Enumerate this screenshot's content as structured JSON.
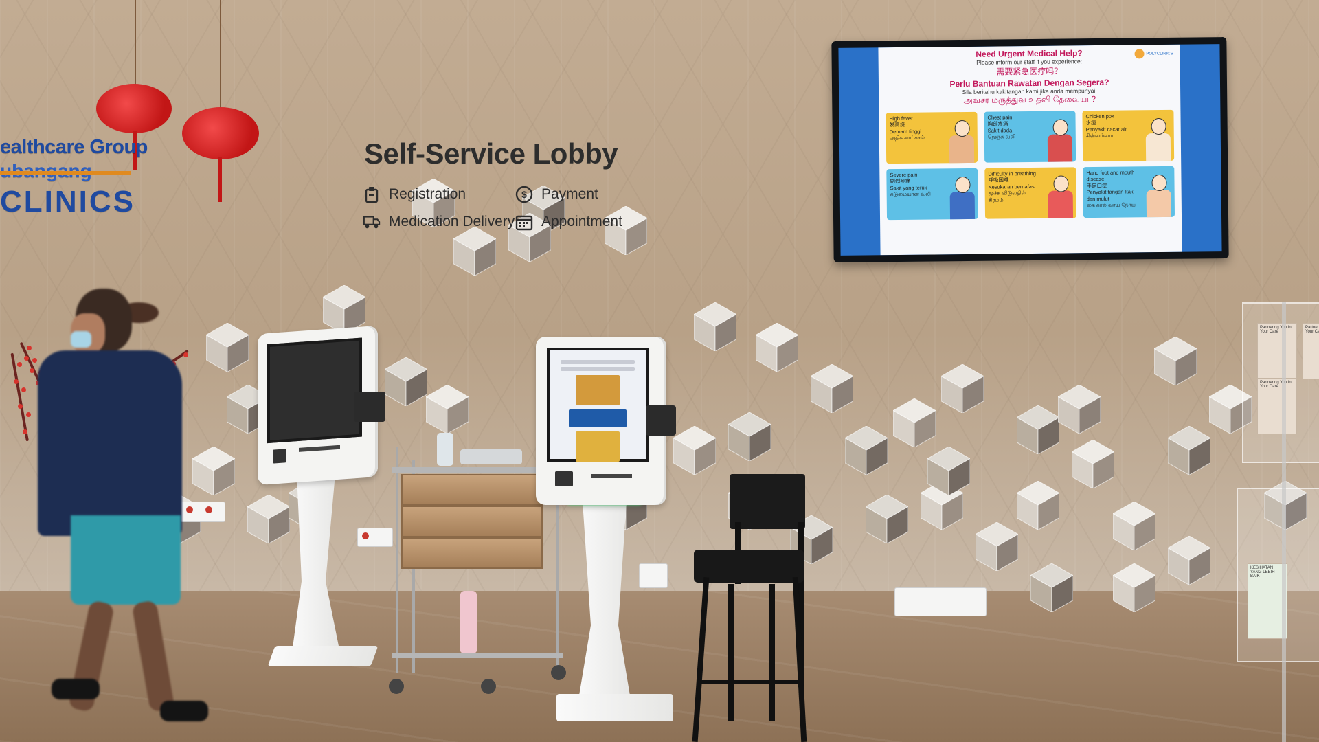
{
  "branding": {
    "line1": "ealthcare Group",
    "line2": "ubangang",
    "line3": "CLINICS",
    "color_primary": "#1f4aa0",
    "color_accent": "#e08a1f"
  },
  "lobby_sign": {
    "title": "Self-Service Lobby",
    "services": [
      {
        "label": "Registration",
        "icon": "registration-icon"
      },
      {
        "label": "Payment",
        "icon": "payment-icon"
      },
      {
        "label": "Medication Delivery",
        "icon": "delivery-truck-icon"
      },
      {
        "label": "Appointment",
        "icon": "calendar-icon"
      }
    ]
  },
  "tv_display": {
    "heading": "Need Urgent Medical Help?",
    "subheading": "Please inform our staff if you experience:",
    "chinese_line": "需要紧急医疗吗？",
    "malay_heading": "Perlu Bantuan Rawatan Dengan Segera?",
    "malay_sub": "Sila beritahu kakitangan kami jika anda mempunyai:",
    "tamil_line": "அவசர மருத்துவ உதவி தேவையா?",
    "logo_text": "POLYCLINICS",
    "cards": [
      {
        "en": "High fever",
        "zh": "发高烧",
        "ms": "Demam tinggi",
        "ta": "அதிக காய்ச்சல்",
        "color": "#f3c33c"
      },
      {
        "en": "Chest pain",
        "zh": "胸部疼痛",
        "ms": "Sakit dada",
        "ta": "நெஞ்சு வலி",
        "color": "#5ec0e6"
      },
      {
        "en": "Chicken pox",
        "zh": "水痘",
        "ms": "Penyakit cacar air",
        "ta": "சின்னம்மை",
        "color": "#f3c33c"
      },
      {
        "en": "Severe pain",
        "zh": "剧烈疼痛",
        "ms": "Sakit yang teruk",
        "ta": "கடுமையான வலி",
        "color": "#5ec0e6"
      },
      {
        "en": "Difficulty in breathing",
        "zh": "呼吸困难",
        "ms": "Kesukaran bernafas",
        "ta": "மூச்சு விடுவதில் சிரமம்",
        "color": "#f3c33c"
      },
      {
        "en": "Hand foot and mouth disease",
        "zh": "手足口症",
        "ms": "Penyakit tangan-kaki dan mulut",
        "ta": "கை கால் வாய் நோய்",
        "color": "#5ec0e6"
      }
    ]
  },
  "rack": {
    "brochures": [
      "Partnering You in Your Care",
      "Partnering You in Your Care",
      "Partnering You in Your Care",
      "KESIHATAN YANG LEBIH BAIK"
    ]
  }
}
